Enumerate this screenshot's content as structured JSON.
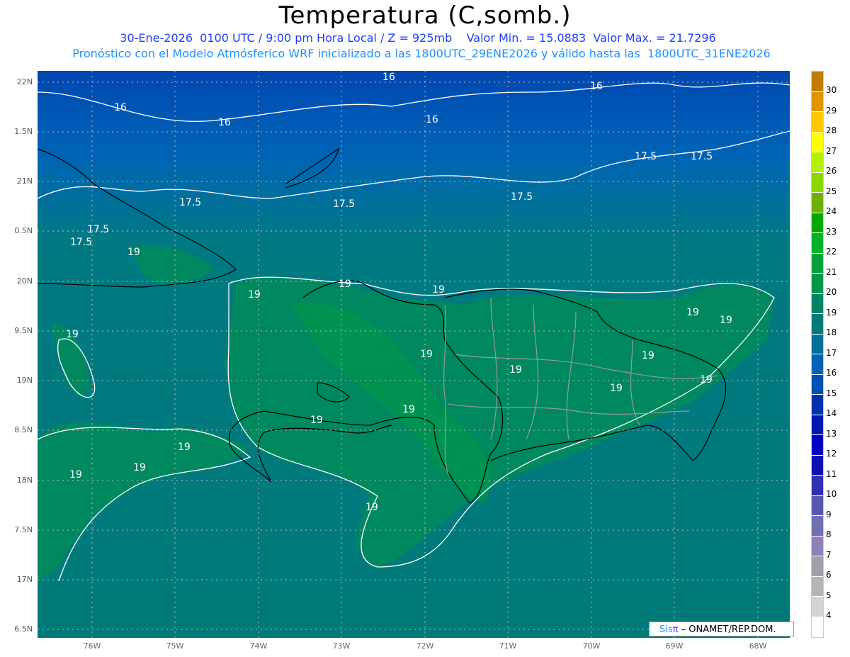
{
  "header": {
    "title": "Temperatura (C,somb.)",
    "line1": "30-Ene-2026  0100 UTC / 9:00 pm Hora Local / Z = 925mb    Valor Min. = 15.0883  Valor Max. = 21.7296",
    "line2": "Pronóstico con el Modelo Atmósferico WRF inicializado a las 1800UTC_29ENE2026 y válido hasta las  1800UTC_31ENE2026"
  },
  "axes": {
    "lat_labels": [
      "22N",
      "1.5N",
      "21N",
      "0.5N",
      "20N",
      "9.5N",
      "19N",
      "8.5N",
      "18N",
      "7.5N",
      "17N",
      "6.5N"
    ],
    "lon_labels": [
      "76W",
      "75W",
      "74W",
      "73W",
      "72W",
      "71W",
      "70W",
      "69W",
      "68W"
    ]
  },
  "contour_labels": [
    "16",
    "16",
    "16",
    "16",
    "16",
    "17.5",
    "17.5",
    "17.5",
    "17.5",
    "17.5",
    "17.5",
    "17.5",
    "19",
    "19",
    "19",
    "19",
    "19",
    "19",
    "19",
    "19",
    "19",
    "19",
    "19",
    "19",
    "19",
    "19",
    "19",
    "19",
    "19",
    "19"
  ],
  "colorbar": {
    "labels": [
      "30",
      "29",
      "28",
      "27",
      "26",
      "25",
      "24",
      "23",
      "22",
      "21",
      "20",
      "19",
      "18",
      "17",
      "16",
      "15",
      "14",
      "13",
      "12",
      "11",
      "10",
      "9",
      "8",
      "7",
      "6",
      "5",
      "4"
    ],
    "colors": [
      "#c07c00",
      "#e09400",
      "#ffc800",
      "#ffff00",
      "#b4f000",
      "#8cd800",
      "#6eb000",
      "#00aa00",
      "#00b428",
      "#00a03c",
      "#00964a",
      "#008264",
      "#007a7a",
      "#00709a",
      "#0064b4",
      "#0050b4",
      "#0032b0",
      "#0018b0",
      "#0000c4",
      "#1010b0",
      "#3030b0",
      "#5858b0",
      "#7070b0",
      "#9080b8",
      "#a0a0a8",
      "#b4b4b4",
      "#d4d4d4",
      "#ffffff"
    ]
  },
  "credit": {
    "sis": "Sis",
    "pi": "π",
    "rest": " – ONAMET/REP.DOM."
  }
}
